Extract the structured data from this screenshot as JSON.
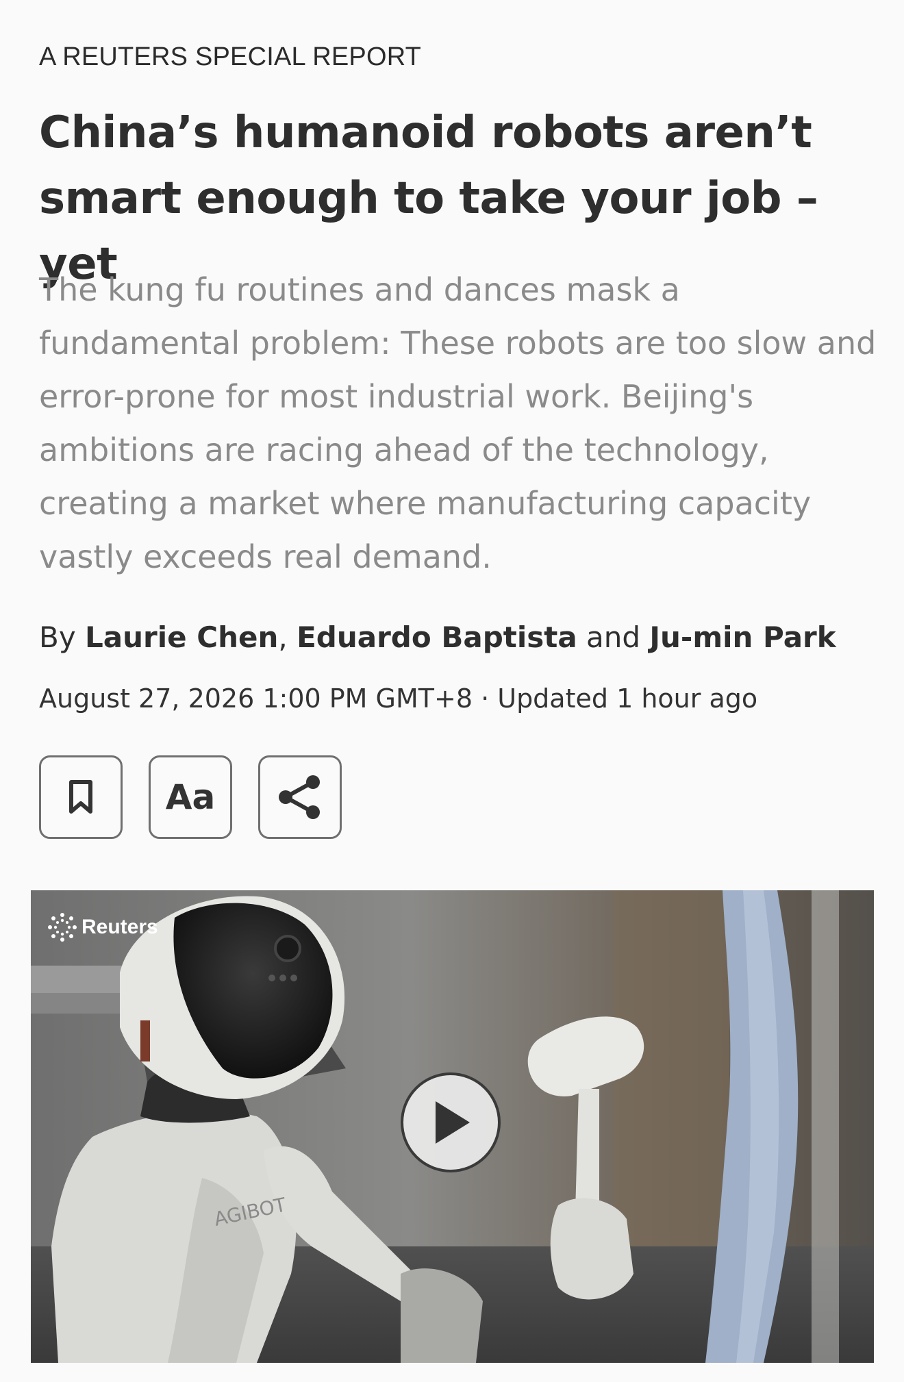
{
  "article": {
    "kicker": "A REUTERS SPECIAL REPORT",
    "headline": "China’s humanoid robots aren’t smart enough to take your job – yet",
    "summary": "The kung fu routines and dances mask a fundamental problem: These robots are too slow and error-prone for most industrial work. Beijing's ambitions are racing ahead of the technology, creating a market where manufacturing capacity vastly exceeds real demand.",
    "byline": {
      "prefix": "By",
      "authors": [
        "Laurie Chen",
        "Eduardo Baptista",
        "Ju-min Park"
      ],
      "separator": ",",
      "conjunction": "and"
    },
    "dateline": "August 27, 2026 1:00 PM GMT+8 · Updated 1 hour ago"
  },
  "toolbar": {
    "bookmark_icon": "bookmark-icon",
    "text_size_label": "Aa",
    "share_icon": "share-icon"
  },
  "media": {
    "watermark": "Reuters",
    "watermark_icon": "reuters-logo-icon",
    "play_icon": "play-icon",
    "robot_marking": "AGIBOT"
  },
  "colors": {
    "background": "#fafafa",
    "headline": "#2e2e2e",
    "summary": "#8a8a8a",
    "button_border": "#6f6f6f"
  }
}
